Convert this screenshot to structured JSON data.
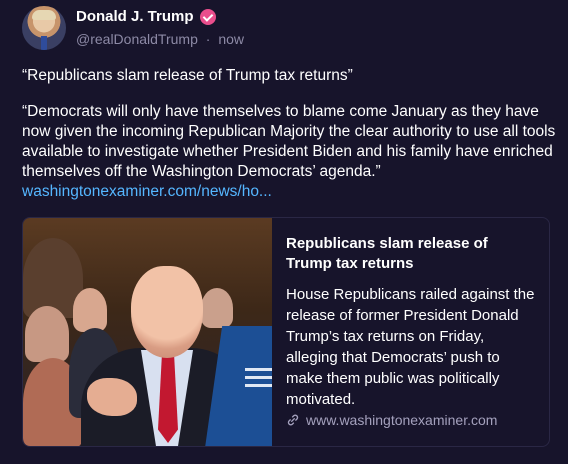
{
  "author": {
    "display_name": "Donald J. Trump",
    "handle": "@realDonaldTrump",
    "separator": "·",
    "time": "now",
    "verified_color": "#e94e8c"
  },
  "post": {
    "quote_line": "“Republicans slam release of Trump tax returns”",
    "body": "“Democrats will only have themselves to blame come January as they have now given the incoming Republican Majority the clear authority to use all tools available to investigate whether President Biden and his family have enriched themselves off the Washington Democrats’ agenda.”",
    "link_text": "washingtonexaminer.com/news/ho..."
  },
  "card": {
    "title": "Republicans slam release of Trump tax returns",
    "description": "House Republicans railed against the release of former President Donald Trump’s tax returns on Friday, alleging that Democrats’ push to make them public was politically motivated.",
    "source": "www.washingtonexaminer.com"
  },
  "colors": {
    "background": "#17142b",
    "link": "#55b6ff",
    "muted": "#8d8aa6"
  }
}
